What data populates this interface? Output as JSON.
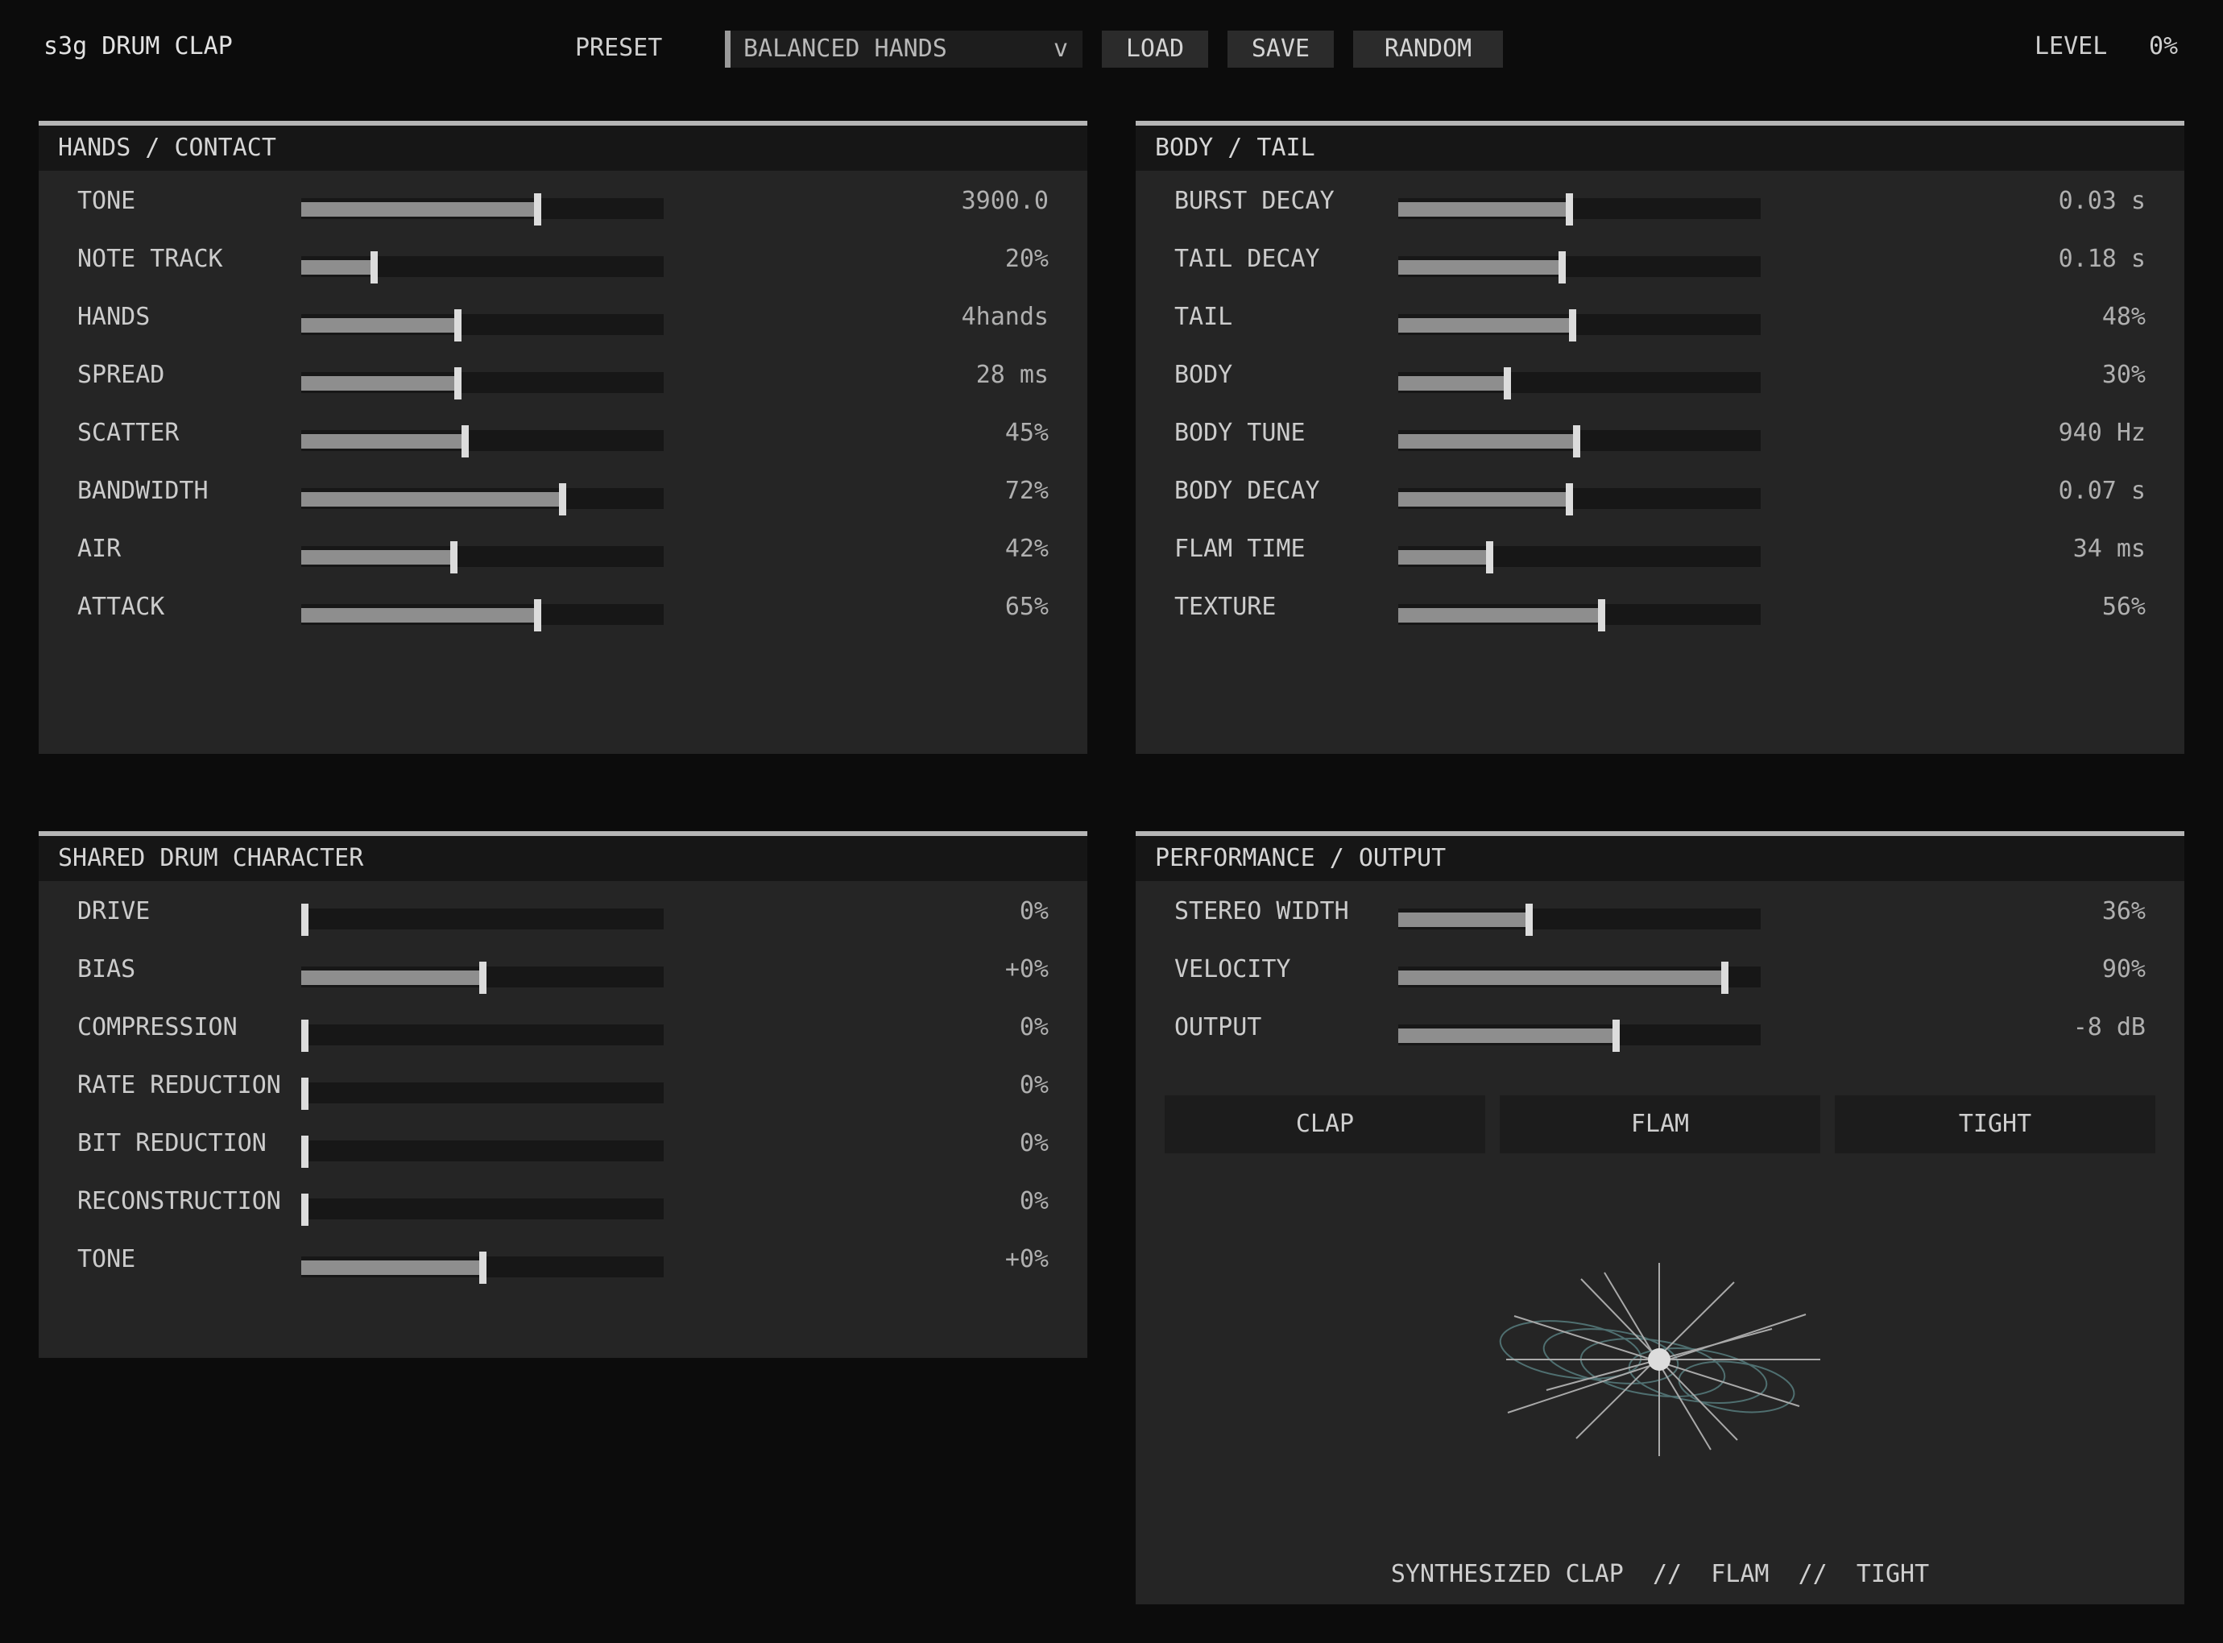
{
  "header": {
    "app_title": "s3g DRUM CLAP",
    "preset_label": "PRESET",
    "preset_value": "BALANCED HANDS",
    "preset_chevron": "v",
    "load_label": "LOAD",
    "save_label": "SAVE",
    "random_label": "RANDOM",
    "level_label": "LEVEL",
    "level_value": "0%"
  },
  "panels": {
    "hands": {
      "title": "HANDS / CONTACT",
      "params": [
        {
          "label": "TONE",
          "value": "3900.0",
          "fraction": 0.65
        },
        {
          "label": "NOTE TRACK",
          "value": "20%",
          "fraction": 0.2
        },
        {
          "label": "HANDS",
          "value": "4hands",
          "fraction": 0.43
        },
        {
          "label": "SPREAD",
          "value": "28 ms",
          "fraction": 0.43
        },
        {
          "label": "SCATTER",
          "value": "45%",
          "fraction": 0.45
        },
        {
          "label": "BANDWIDTH",
          "value": "72%",
          "fraction": 0.72
        },
        {
          "label": "AIR",
          "value": "42%",
          "fraction": 0.42
        },
        {
          "label": "ATTACK",
          "value": "65%",
          "fraction": 0.65
        }
      ]
    },
    "body": {
      "title": "BODY / TAIL",
      "params": [
        {
          "label": "BURST DECAY",
          "value": "0.03 s",
          "fraction": 0.47
        },
        {
          "label": "TAIL DECAY",
          "value": "0.18 s",
          "fraction": 0.45
        },
        {
          "label": "TAIL",
          "value": "48%",
          "fraction": 0.48
        },
        {
          "label": "BODY",
          "value": "30%",
          "fraction": 0.3
        },
        {
          "label": "BODY TUNE",
          "value": "940 Hz",
          "fraction": 0.49
        },
        {
          "label": "BODY DECAY",
          "value": "0.07 s",
          "fraction": 0.47
        },
        {
          "label": "FLAM TIME",
          "value": "34 ms",
          "fraction": 0.25
        },
        {
          "label": "TEXTURE",
          "value": "56%",
          "fraction": 0.56
        }
      ]
    },
    "shared": {
      "title": "SHARED DRUM CHARACTER",
      "params": [
        {
          "label": "DRIVE",
          "value": "0%",
          "fraction": 0.0
        },
        {
          "label": "BIAS",
          "value": "+0%",
          "fraction": 0.5
        },
        {
          "label": "COMPRESSION",
          "value": "0%",
          "fraction": 0.0
        },
        {
          "label": "RATE REDUCTION",
          "value": "0%",
          "fraction": 0.0
        },
        {
          "label": "BIT REDUCTION",
          "value": "0%",
          "fraction": 0.0
        },
        {
          "label": "RECONSTRUCTION",
          "value": "0%",
          "fraction": 0.0
        },
        {
          "label": "TONE",
          "value": "+0%",
          "fraction": 0.5
        }
      ]
    },
    "performance": {
      "title": "PERFORMANCE / OUTPUT",
      "params": [
        {
          "label": "STEREO WIDTH",
          "value": "36%",
          "fraction": 0.36
        },
        {
          "label": "VELOCITY",
          "value": "90%",
          "fraction": 0.9
        },
        {
          "label": "OUTPUT",
          "value": "-8 dB",
          "fraction": 0.6
        }
      ],
      "modes": [
        "CLAP",
        "FLAM",
        "TIGHT"
      ],
      "footer": "SYNTHESIZED CLAP  //  FLAM  //  TIGHT"
    }
  },
  "colors": {
    "background": "#0c0c0c",
    "panel": "#252525",
    "track": "#171717",
    "fill": "#8e8e8e",
    "visual_ring": "#4f6f70"
  }
}
